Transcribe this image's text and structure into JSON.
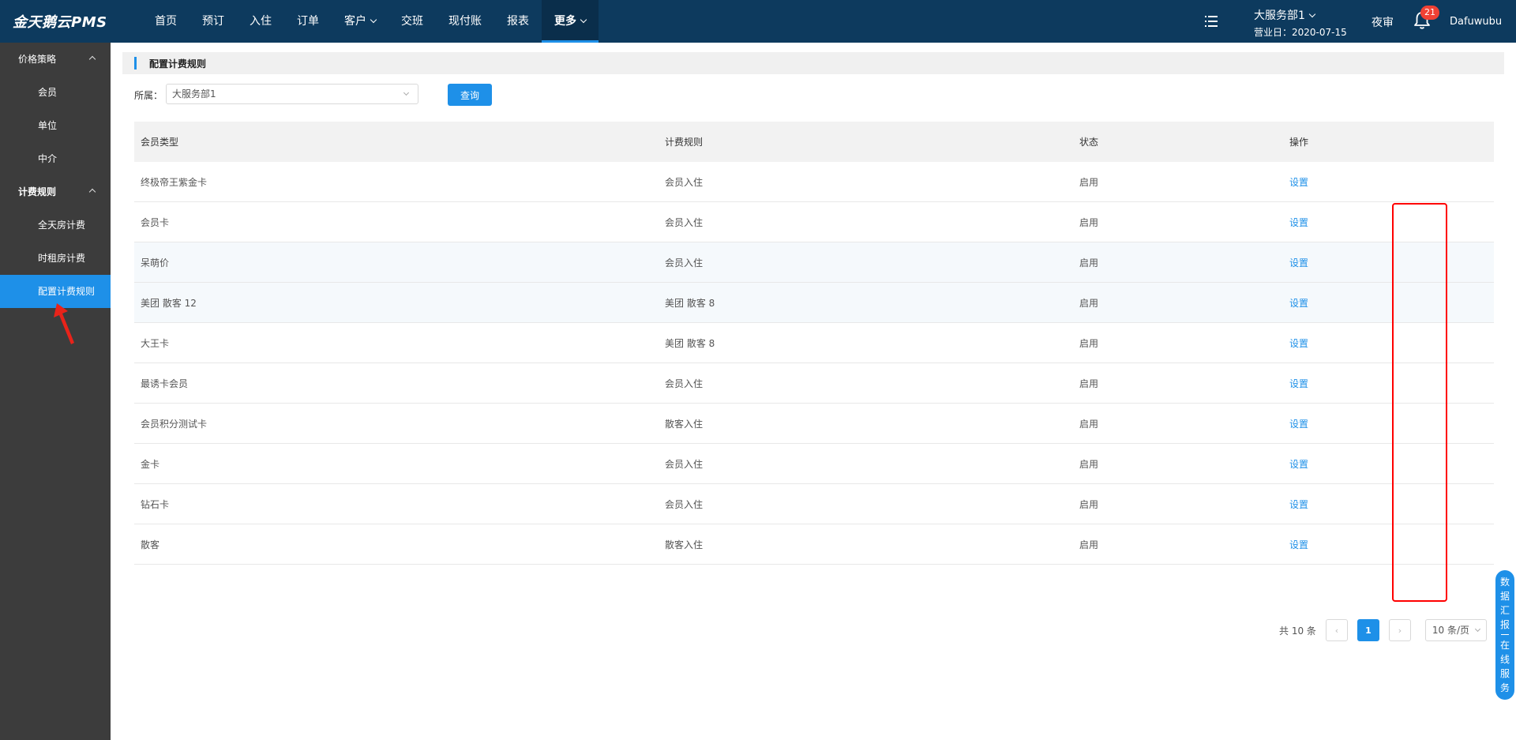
{
  "app": {
    "logo": "金天鹅云PMS"
  },
  "nav": {
    "items": [
      {
        "label": "首页"
      },
      {
        "label": "预订"
      },
      {
        "label": "入住"
      },
      {
        "label": "订单"
      },
      {
        "label": "客户"
      },
      {
        "label": "交班"
      },
      {
        "label": "现付账"
      },
      {
        "label": "报表"
      },
      {
        "label": "更多"
      }
    ],
    "active": "更多"
  },
  "header_right": {
    "department": "大服务部1",
    "business_date": "营业日：2020-07-15",
    "night_audit": "夜审",
    "notification_count": "21",
    "username": "Dafuwubu"
  },
  "sidebar": {
    "groups": [
      {
        "label": "价格策略",
        "items": [
          "会员",
          "单位",
          "中介"
        ]
      },
      {
        "label": "计费规则",
        "items": [
          "全天房计费",
          "时租房计费",
          "配置计费规则"
        ]
      }
    ],
    "active_item": "配置计费规则"
  },
  "page": {
    "title": "配置计费规则",
    "filter_label": "所属：",
    "filter_value": "大服务部1",
    "query_button": "查询"
  },
  "table": {
    "headers": [
      "会员类型",
      "计费规则",
      "状态",
      "操作"
    ],
    "rows": [
      {
        "type": "终极帝王紫金卡",
        "rule": "会员入住",
        "status": "启用",
        "action": "设置"
      },
      {
        "type": "会员卡",
        "rule": "会员入住",
        "status": "启用",
        "action": "设置"
      },
      {
        "type": "呆萌价",
        "rule": "会员入住",
        "status": "启用",
        "action": "设置"
      },
      {
        "type": "美团 散客 12",
        "rule": "美团 散客 8",
        "status": "启用",
        "action": "设置"
      },
      {
        "type": "大王卡",
        "rule": "美团 散客 8",
        "status": "启用",
        "action": "设置"
      },
      {
        "type": "最诱卡会员",
        "rule": "会员入住",
        "status": "启用",
        "action": "设置"
      },
      {
        "type": "会员积分测试卡",
        "rule": "散客入住",
        "status": "启用",
        "action": "设置"
      },
      {
        "type": "金卡",
        "rule": "会员入住",
        "status": "启用",
        "action": "设置"
      },
      {
        "type": "钻石卡",
        "rule": "会员入住",
        "status": "启用",
        "action": "设置"
      },
      {
        "type": "散客",
        "rule": "散客入住",
        "status": "启用",
        "action": "设置"
      }
    ]
  },
  "pagination": {
    "total": "共 10 条",
    "prev": "‹",
    "current_page": "1",
    "next": "›",
    "page_size": "10 条/页"
  },
  "floating": {
    "part1": [
      "数",
      "据",
      "汇",
      "报"
    ],
    "part2": [
      "在",
      "线",
      "服",
      "务"
    ]
  },
  "colors": {
    "topbar": "#0d3a5e",
    "sidebar": "#3c3c3c",
    "accent": "#1e90e8",
    "highlight_box": "#ff0000"
  },
  "icons": [
    "list-icon",
    "bell-icon",
    "chevron-down-icon",
    "chevron-up-icon",
    "arrow-annotation-icon"
  ]
}
